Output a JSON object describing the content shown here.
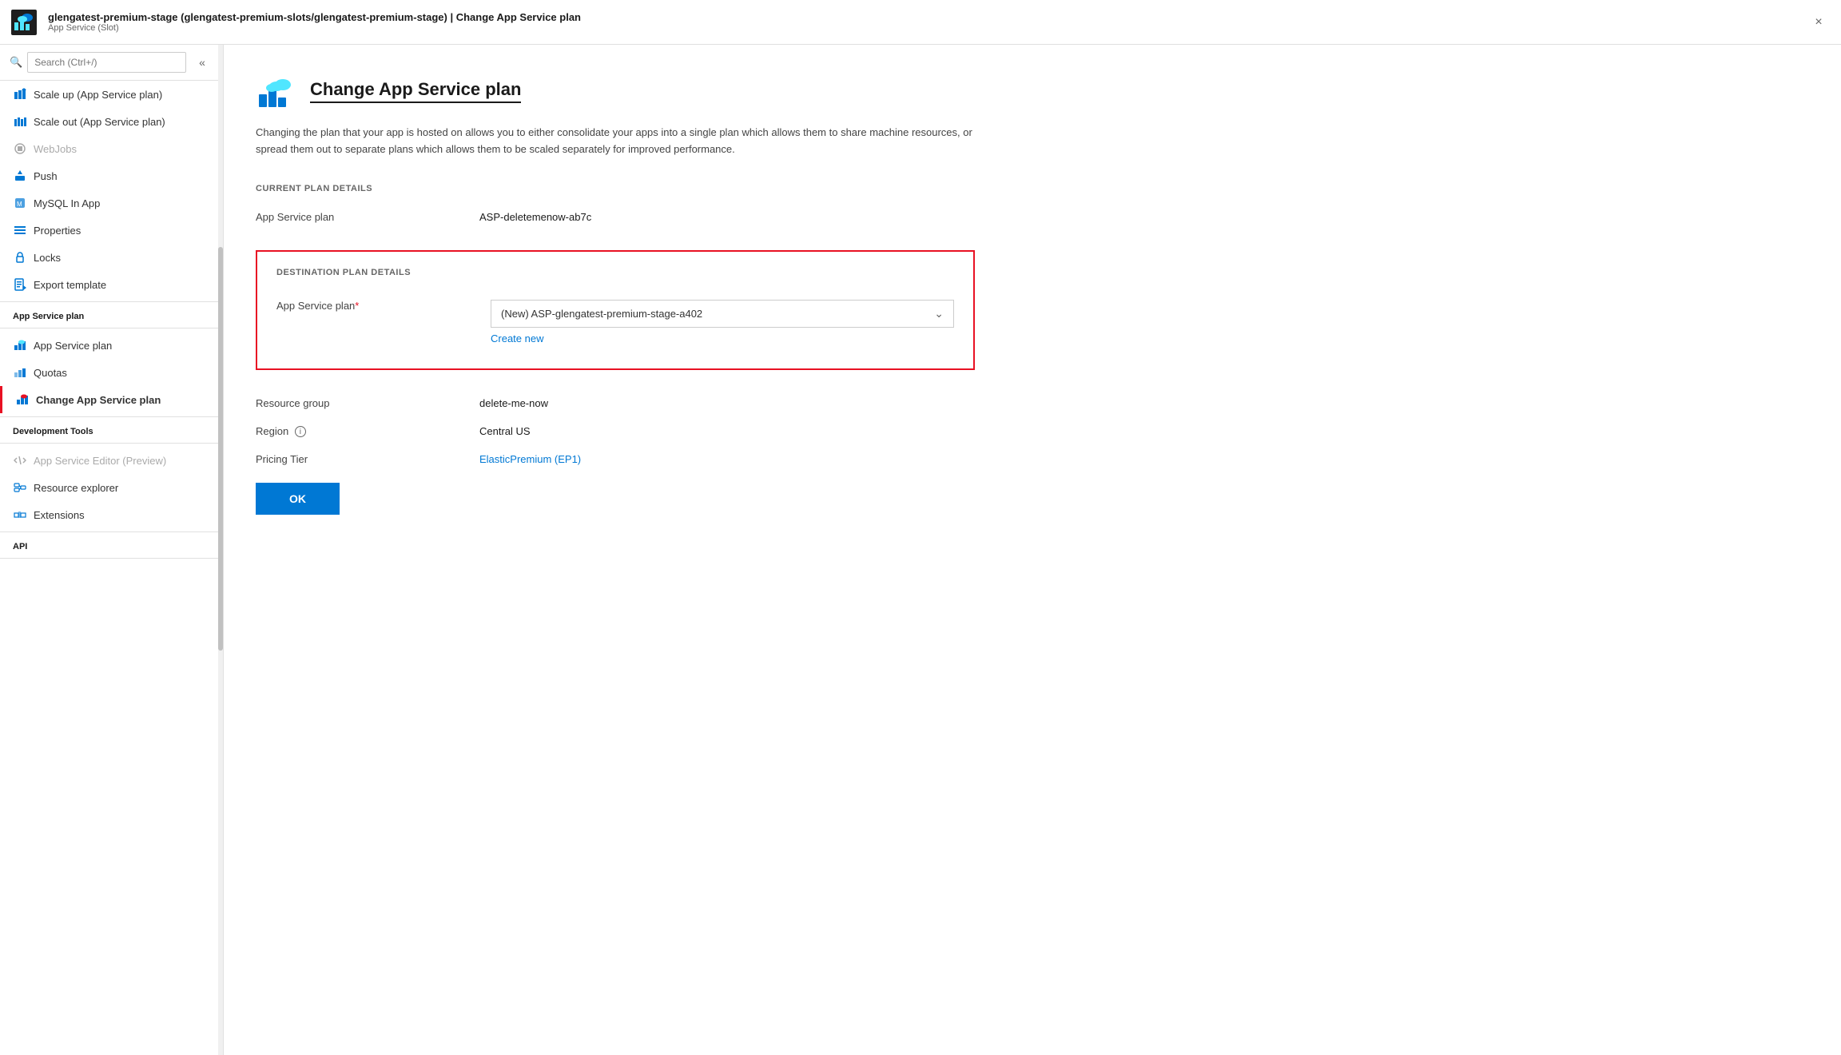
{
  "titleBar": {
    "title": "glengatest-premium-stage (glengatest-premium-slots/glengatest-premium-stage) | Change App Service plan",
    "subtitle": "App Service (Slot)",
    "closeLabel": "×"
  },
  "sidebar": {
    "searchPlaceholder": "Search (Ctrl+/)",
    "collapseIcon": "«",
    "items": [
      {
        "id": "scale-up",
        "label": "Scale up (App Service plan)",
        "icon": "scale-up",
        "disabled": false,
        "active": false
      },
      {
        "id": "scale-out",
        "label": "Scale out (App Service plan)",
        "icon": "scale-out",
        "disabled": false,
        "active": false
      },
      {
        "id": "webjobs",
        "label": "WebJobs",
        "icon": "webjobs",
        "disabled": true,
        "active": false
      },
      {
        "id": "push",
        "label": "Push",
        "icon": "push",
        "disabled": false,
        "active": false
      },
      {
        "id": "mysql-in-app",
        "label": "MySQL In App",
        "icon": "mysql",
        "disabled": false,
        "active": false
      },
      {
        "id": "properties",
        "label": "Properties",
        "icon": "properties",
        "disabled": false,
        "active": false
      },
      {
        "id": "locks",
        "label": "Locks",
        "icon": "locks",
        "disabled": false,
        "active": false
      },
      {
        "id": "export-template",
        "label": "Export template",
        "icon": "export-template",
        "disabled": false,
        "active": false
      }
    ],
    "sections": [
      {
        "label": "App Service plan",
        "items": [
          {
            "id": "app-service-plan",
            "label": "App Service plan",
            "icon": "app-service-plan",
            "disabled": false,
            "active": false
          },
          {
            "id": "quotas",
            "label": "Quotas",
            "icon": "quotas",
            "disabled": false,
            "active": false
          },
          {
            "id": "change-app-service-plan",
            "label": "Change App Service plan",
            "icon": "change-plan",
            "disabled": false,
            "active": true
          }
        ]
      },
      {
        "label": "Development Tools",
        "items": [
          {
            "id": "app-service-editor",
            "label": "App Service Editor (Preview)",
            "icon": "editor",
            "disabled": true,
            "active": false
          },
          {
            "id": "resource-explorer",
            "label": "Resource explorer",
            "icon": "resource-explorer",
            "disabled": false,
            "active": false
          },
          {
            "id": "extensions",
            "label": "Extensions",
            "icon": "extensions",
            "disabled": false,
            "active": false
          }
        ]
      },
      {
        "label": "API",
        "items": []
      }
    ]
  },
  "content": {
    "pageTitle": "Change App Service plan",
    "description": "Changing the plan that your app is hosted on allows you to either consolidate your apps into a single plan which allows them to share machine resources, or spread them out to separate plans which allows them to be scaled separately for improved performance.",
    "currentPlan": {
      "sectionLabel": "CURRENT PLAN DETAILS",
      "appServicePlanLabel": "App Service plan",
      "appServicePlanValue": "ASP-deletemenow-ab7c"
    },
    "destinationPlan": {
      "sectionLabel": "DESTINATION PLAN DETAILS",
      "appServicePlanLabel": "App Service plan",
      "requiredStar": "*",
      "dropdownValue": "(New) ASP-glengatest-premium-stage-a402",
      "createNewLabel": "Create new",
      "resourceGroupLabel": "Resource group",
      "resourceGroupValue": "delete-me-now",
      "regionLabel": "Region",
      "regionValue": "Central US",
      "pricingTierLabel": "Pricing Tier",
      "pricingTierValue": "ElasticPremium (EP1)"
    },
    "okButton": "OK"
  }
}
